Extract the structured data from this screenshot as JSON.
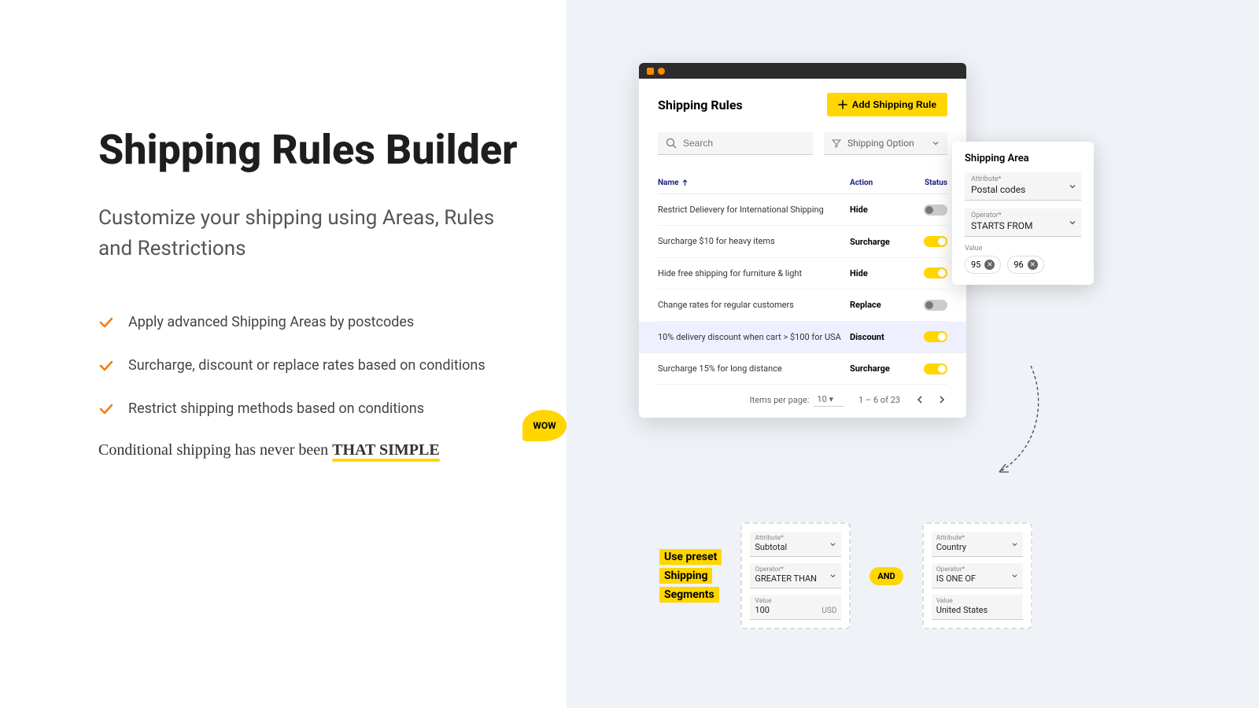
{
  "left": {
    "title": "Shipping Rules Builder",
    "subtitle": "Customize your shipping using Areas, Rules and Restrictions",
    "bullets": [
      "Apply advanced Shipping Areas by postcodes",
      "Surcharge, discount or replace rates based on conditions",
      "Restrict shipping methods based on conditions"
    ],
    "tagline_prefix": "Conditional shipping has never been ",
    "tagline_highlight": "THAT SIMPLE",
    "wow": "WOW"
  },
  "app": {
    "title": "Shipping Rules",
    "addBtn": "Add Shipping Rule",
    "searchPlaceholder": "Search",
    "filterLabel": "Shipping Option",
    "headers": {
      "name": "Name",
      "action": "Action",
      "status": "Status"
    },
    "rows": [
      {
        "name": "Restrict Delievery for International Shipping",
        "action": "Hide",
        "on": false
      },
      {
        "name": "Surcharge $10 for heavy items",
        "action": "Surcharge",
        "on": true
      },
      {
        "name": "Hide free shipping for furniture & light",
        "action": "Hide",
        "on": true
      },
      {
        "name": "Change rates for regular customers",
        "action": "Replace",
        "on": false
      },
      {
        "name": "10% delivery discount when cart > $100 for USA",
        "action": "Discount",
        "on": true,
        "highlight": true
      },
      {
        "name": "Surcharge 15% for long distance",
        "action": "Surcharge",
        "on": true
      }
    ],
    "footer": {
      "perPageLabel": "Items per page:",
      "perPage": "10",
      "range": "1 – 6 of 23"
    }
  },
  "area": {
    "title": "Shipping Area",
    "attrLabel": "Attribute*",
    "attrValue": "Postal codes",
    "opLabel": "Operator*",
    "opValue": "STARTS FROM",
    "valLabel": "Value",
    "chips": [
      "95",
      "96"
    ]
  },
  "preset": {
    "l1": "Use preset",
    "l2": "Shipping",
    "l3": "Segments"
  },
  "cond1": {
    "attrLabel": "Attribute*",
    "attrValue": "Subtotal",
    "opLabel": "Operator*",
    "opValue": "GREATER THAN",
    "valLabel": "Value",
    "valValue": "100",
    "valSuffix": "USD"
  },
  "andLabel": "AND",
  "cond2": {
    "attrLabel": "Attribute*",
    "attrValue": "Country",
    "opLabel": "Operator*",
    "opValue": "IS ONE OF",
    "valLabel": "Value",
    "valValue": "United States"
  }
}
